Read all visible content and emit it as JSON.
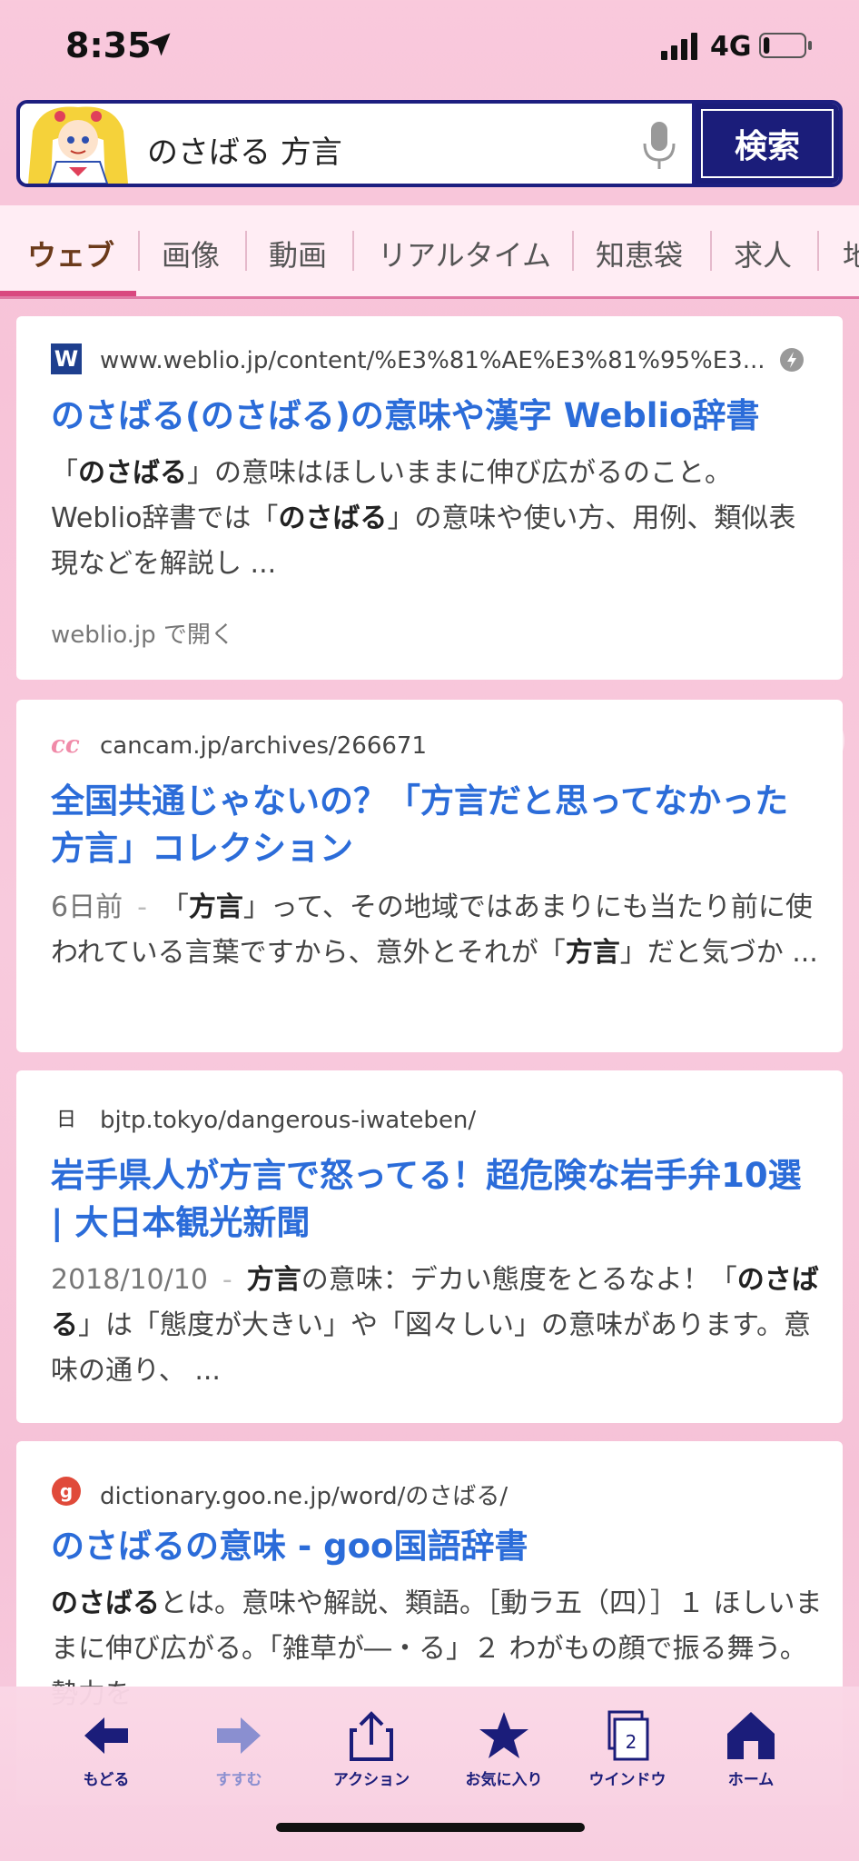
{
  "status_bar": {
    "time": "8:35",
    "network": "4G",
    "battery_level": 0.15
  },
  "search": {
    "query": "のさばる 方言",
    "button_label": "検索"
  },
  "tabs": [
    {
      "label": "ウェブ",
      "active": true
    },
    {
      "label": "画像"
    },
    {
      "label": "動画"
    },
    {
      "label": "リアルタイム"
    },
    {
      "label": "知恵袋"
    },
    {
      "label": "求人"
    },
    {
      "label": "地"
    }
  ],
  "results": [
    {
      "favicon": "W",
      "url": "www.weblio.jp/content/%E3%81%AE%E3%81%95%E3...",
      "title": "のさばる(のさばる)の意味や漢字 Weblio辞書",
      "snippet": "「<b>のさばる</b>」の意味はほしいままに伸び広がるのこと。Weblio辞書では「<b>のさばる</b>」の意味や使い方、用例、類似表現などを解説し ...",
      "open_link": "weblio.jp で開く"
    },
    {
      "favicon": "cc",
      "url": "cancam.jp/archives/266671",
      "title": "全国共通じゃないの？「方言だと思ってなかった方言」コレクション",
      "date": "6日前",
      "snippet": "「<b>方言</b>」って、その地域ではあまりにも当たり前に使われている言葉ですから、意外とそれが「<b>方言</b>」だと気づか ..."
    },
    {
      "favicon": "日",
      "url": "bjtp.tokyo/dangerous-iwateben/",
      "title": "岩手県人が方言で怒ってる！超危険な岩手弁10選 | 大日本観光新聞",
      "date": "2018/10/10",
      "snippet": "<b>方言</b>の意味：デカい態度をとるなよ！「<b>のさばる</b>」は「態度が大きい」や「図々しい」の意味があります。意味の通り、 ..."
    },
    {
      "favicon": "g",
      "url": "dictionary.goo.ne.jp/word/のさばる/",
      "title": "のさばるの意味 - goo国語辞書",
      "snippet": "<b>のさばる</b>とは。意味や解説、類語。［動ラ五（四）］１ ほしいままに伸び広がる。「雑草が―・る」２ わがもの顔で振る舞う。勢力を"
    }
  ],
  "toolbar": {
    "back": "もどる",
    "forward": "すすむ",
    "action": "アクション",
    "favorites": "お気に入り",
    "window": "ウインドウ",
    "window_count": "2",
    "home": "ホーム"
  },
  "colors": {
    "navy": "#1b1d7a",
    "link": "#2b6cd9",
    "pink_accent": "#d9487f"
  }
}
